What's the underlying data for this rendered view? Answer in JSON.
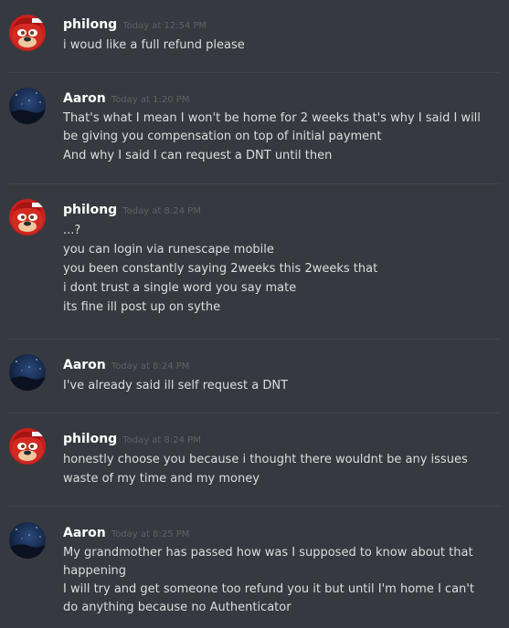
{
  "messages": [
    {
      "author": "philong",
      "timestamp": "Today at 12:54 PM",
      "avatar_icon": "knuckles-avatar",
      "lines": [
        "i woud like a full refund please"
      ]
    },
    {
      "author": "Aaron",
      "timestamp": "Today at 1:20 PM",
      "avatar_icon": "night-sky-avatar",
      "lines": [
        "That's what I mean I won't be home for 2 weeks that's why I said I will be giving you compensation on top of initial payment",
        "And why I said I can request a DNT until then"
      ]
    },
    {
      "author": "philong",
      "timestamp": "Today at 8:24 PM",
      "avatar_icon": "knuckles-avatar",
      "lines": [
        "...?",
        "you can login via runescape mobile",
        "you been constantly saying 2weeks this 2weeks that",
        "i dont trust a single word you say mate",
        "its fine ill post up on sythe"
      ]
    },
    {
      "author": "Aaron",
      "timestamp": "Today at 8:24 PM",
      "avatar_icon": "night-sky-avatar",
      "lines": [
        "I've already said ill self request a DNT"
      ]
    },
    {
      "author": "philong",
      "timestamp": "Today at 8:24 PM",
      "avatar_icon": "knuckles-avatar",
      "lines": [
        "honestly choose you because i thought there wouldnt be any issues",
        "waste of my time and my money"
      ]
    },
    {
      "author": "Aaron",
      "timestamp": "Today at 8:25 PM",
      "avatar_icon": "night-sky-avatar",
      "lines": [
        "My grandmother has passed how was I supposed to know about that happening",
        "I will try and get someone too refund you it but until I'm home I can't do anything because no Authenticator"
      ]
    }
  ],
  "colors": {
    "background": "#36393f",
    "username": "#ffffff",
    "timestamp": "#5f6268",
    "message_text": "#dcddde",
    "divider": "#40434a"
  }
}
